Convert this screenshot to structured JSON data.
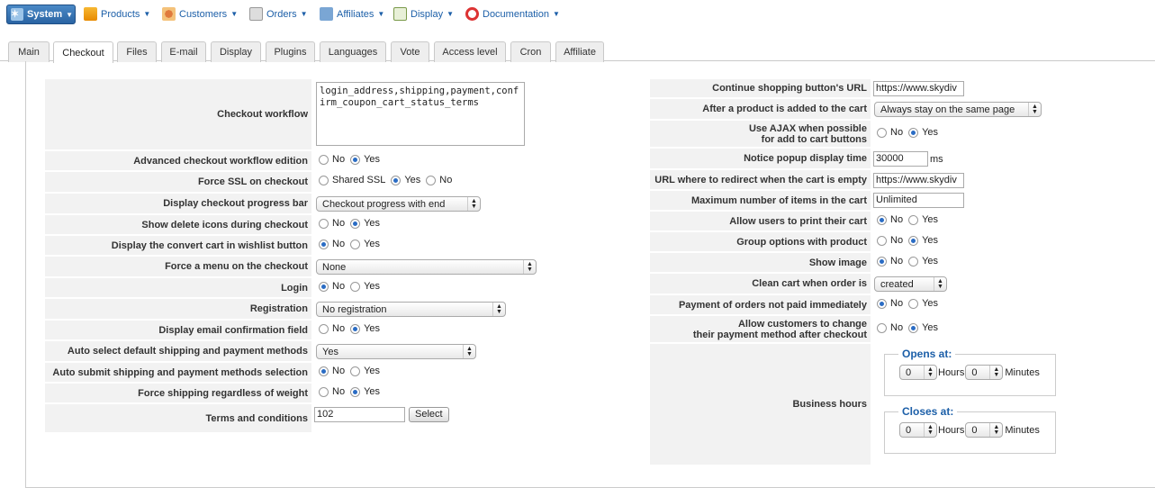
{
  "menu": {
    "system": "System",
    "products": "Products",
    "customers": "Customers",
    "orders": "Orders",
    "affiliates": "Affiliates",
    "display": "Display",
    "documentation": "Documentation"
  },
  "tabs": [
    "Main",
    "Checkout",
    "Files",
    "E-mail",
    "Display",
    "Plugins",
    "Languages",
    "Vote",
    "Access level",
    "Cron",
    "Affiliate"
  ],
  "left": {
    "checkout_workflow": {
      "label": "Checkout workflow",
      "value": "login_address,shipping,payment,confirm_coupon_cart_status_terms"
    },
    "advanced_edition": {
      "label": "Advanced checkout workflow edition",
      "no": "No",
      "yes": "Yes"
    },
    "force_ssl": {
      "label": "Force SSL on checkout",
      "shared": "Shared SSL",
      "yes": "Yes",
      "no": "No"
    },
    "progress_bar": {
      "label": "Display checkout progress bar",
      "value": "Checkout progress with end"
    },
    "delete_icons": {
      "label": "Show delete icons during checkout",
      "no": "No",
      "yes": "Yes"
    },
    "convert_cart": {
      "label": "Display the convert cart in wishlist button",
      "no": "No",
      "yes": "Yes"
    },
    "force_menu": {
      "label": "Force a menu on the checkout",
      "value": "None"
    },
    "login": {
      "label": "Login",
      "no": "No",
      "yes": "Yes"
    },
    "registration": {
      "label": "Registration",
      "value": "No registration"
    },
    "email_confirm": {
      "label": "Display email confirmation field",
      "no": "No",
      "yes": "Yes"
    },
    "auto_select": {
      "label": "Auto select default shipping and payment methods",
      "value": "Yes"
    },
    "auto_submit": {
      "label": "Auto submit shipping and payment methods selection",
      "no": "No",
      "yes": "Yes"
    },
    "force_shipping": {
      "label": "Force shipping regardless of weight",
      "no": "No",
      "yes": "Yes"
    },
    "terms": {
      "label": "Terms and conditions",
      "value": "102",
      "button": "Select"
    }
  },
  "right": {
    "continue_url": {
      "label": "Continue shopping button's URL",
      "value": "https://www.skydiv"
    },
    "after_add": {
      "label": "After a product is added to the cart",
      "value": "Always stay on the same page"
    },
    "ajax": {
      "label1": "Use AJAX when possible",
      "label2": "for add to cart buttons",
      "no": "No",
      "yes": "Yes"
    },
    "popup_time": {
      "label": "Notice popup display time",
      "value": "30000",
      "unit": "ms"
    },
    "redirect_url": {
      "label": "URL where to redirect when the cart is empty",
      "value": "https://www.skydiv"
    },
    "max_items": {
      "label": "Maximum number of items in the cart",
      "value": "Unlimited"
    },
    "print_cart": {
      "label": "Allow users to print their cart",
      "no": "No",
      "yes": "Yes"
    },
    "group_options": {
      "label": "Group options with product",
      "no": "No",
      "yes": "Yes"
    },
    "show_image": {
      "label": "Show image",
      "no": "No",
      "yes": "Yes"
    },
    "clean_cart": {
      "label": "Clean cart when order is",
      "value": "created"
    },
    "payment_not_paid": {
      "label": "Payment of orders not paid immediately",
      "no": "No",
      "yes": "Yes"
    },
    "change_payment": {
      "label1": "Allow customers to change",
      "label2": "their payment method after checkout",
      "no": "No",
      "yes": "Yes"
    },
    "business_hours": {
      "label": "Business hours",
      "opens": "Opens at:",
      "closes": "Closes at:",
      "hours_label": "Hours",
      "minutes_label": "Minutes",
      "open_h": "0",
      "open_m": "0",
      "close_h": "0",
      "close_m": "0"
    }
  }
}
